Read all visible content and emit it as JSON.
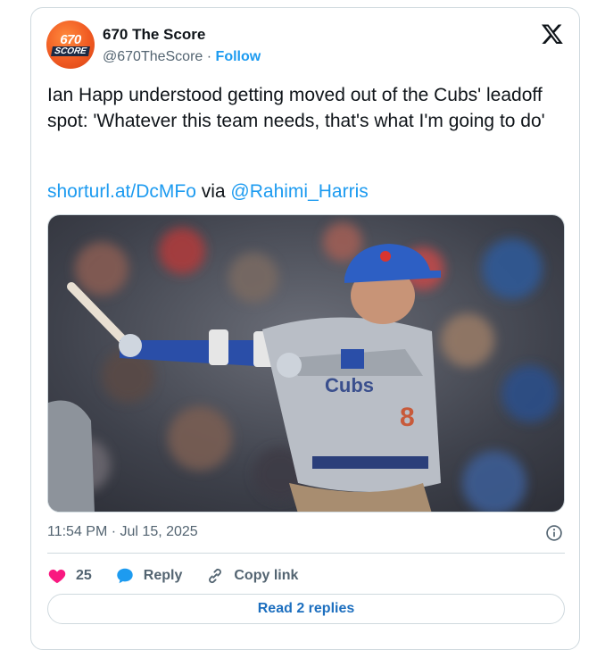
{
  "author": {
    "name": "670 The Score",
    "handle": "@670TheScore",
    "separator": "·",
    "follow_label": "Follow",
    "avatar_text_top": "670",
    "avatar_text_bottom": "SCORE"
  },
  "tweet": {
    "text": "Ian Happ understood getting moved out of the Cubs' leadoff spot: 'Whatever this team needs, that's what I'm going to do'",
    "link": "shorturl.at/DcMFo",
    "via_label": "via",
    "mention": "@Rahimi_Harris"
  },
  "meta": {
    "timestamp": "11:54 PM · Jul 15, 2025"
  },
  "actions": {
    "like_count": "25",
    "reply_label": "Reply",
    "copy_link_label": "Copy link",
    "read_replies_label": "Read 2 replies"
  },
  "icons": {
    "platform": "x-logo-icon",
    "like": "heart-icon",
    "reply": "speech-bubble-icon",
    "copy": "link-icon",
    "info": "info-icon"
  },
  "colors": {
    "link": "#1d9bf0",
    "like": "#f91880",
    "reply": "#1d9bf0",
    "avatar": "#f05a22"
  }
}
